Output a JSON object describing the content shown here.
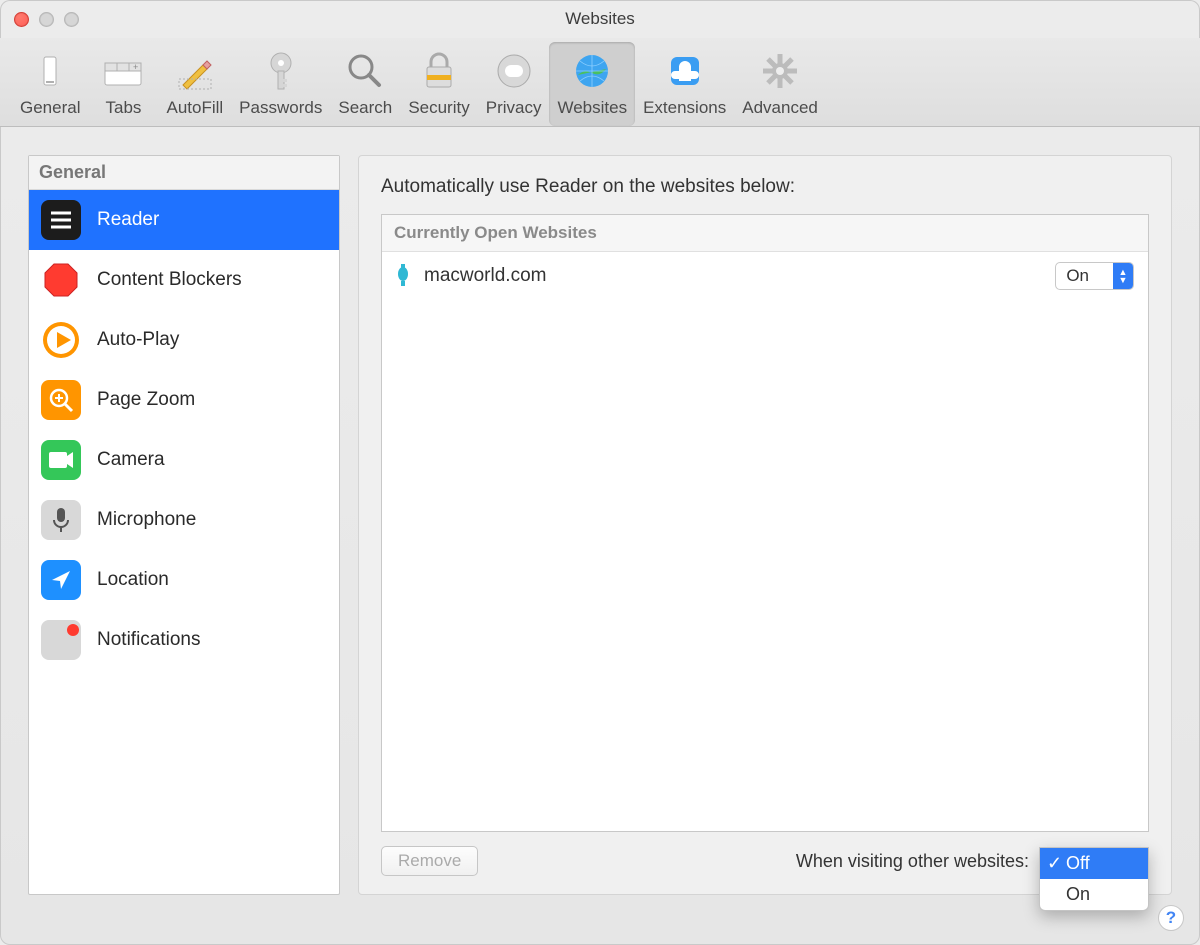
{
  "window": {
    "title": "Websites"
  },
  "toolbar": {
    "items": [
      {
        "label": "General"
      },
      {
        "label": "Tabs"
      },
      {
        "label": "AutoFill"
      },
      {
        "label": "Passwords"
      },
      {
        "label": "Search"
      },
      {
        "label": "Security"
      },
      {
        "label": "Privacy"
      },
      {
        "label": "Websites"
      },
      {
        "label": "Extensions"
      },
      {
        "label": "Advanced"
      }
    ]
  },
  "sidebar": {
    "section": "General",
    "items": [
      {
        "label": "Reader"
      },
      {
        "label": "Content Blockers"
      },
      {
        "label": "Auto-Play"
      },
      {
        "label": "Page Zoom"
      },
      {
        "label": "Camera"
      },
      {
        "label": "Microphone"
      },
      {
        "label": "Location"
      },
      {
        "label": "Notifications"
      }
    ]
  },
  "main": {
    "heading": "Automatically use Reader on the websites below:",
    "listHeader": "Currently Open Websites",
    "rows": [
      {
        "domain": "macworld.com",
        "setting": "On"
      }
    ],
    "removeLabel": "Remove",
    "otherLabel": "When visiting other websites:",
    "dropdown": {
      "options": [
        {
          "label": "Off",
          "selected": true
        },
        {
          "label": "On",
          "selected": false
        }
      ]
    }
  }
}
